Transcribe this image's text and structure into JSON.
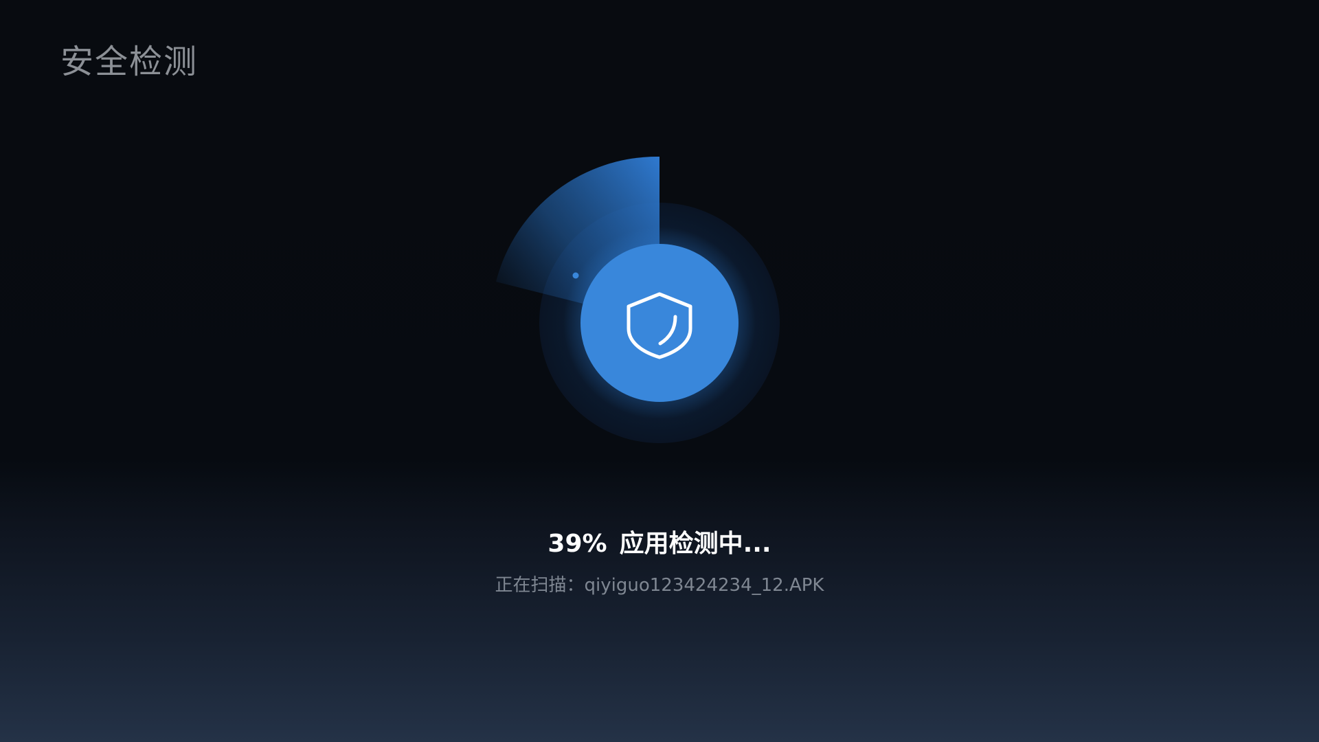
{
  "page": {
    "title": "安全检测"
  },
  "scan": {
    "progress_percent": 39,
    "progress_label": "39%",
    "status_text": "应用检测中...",
    "scanning_prefix": "正在扫描：",
    "current_file": "qiyiguo123424234_12.APK"
  },
  "icon": {
    "center_icon": "shield-icon"
  },
  "colors": {
    "accent": "#3987db",
    "sweep": "#2f79cf",
    "title": "#8c9096",
    "secondary_text": "#7f8792",
    "primary_text": "#ffffff"
  }
}
